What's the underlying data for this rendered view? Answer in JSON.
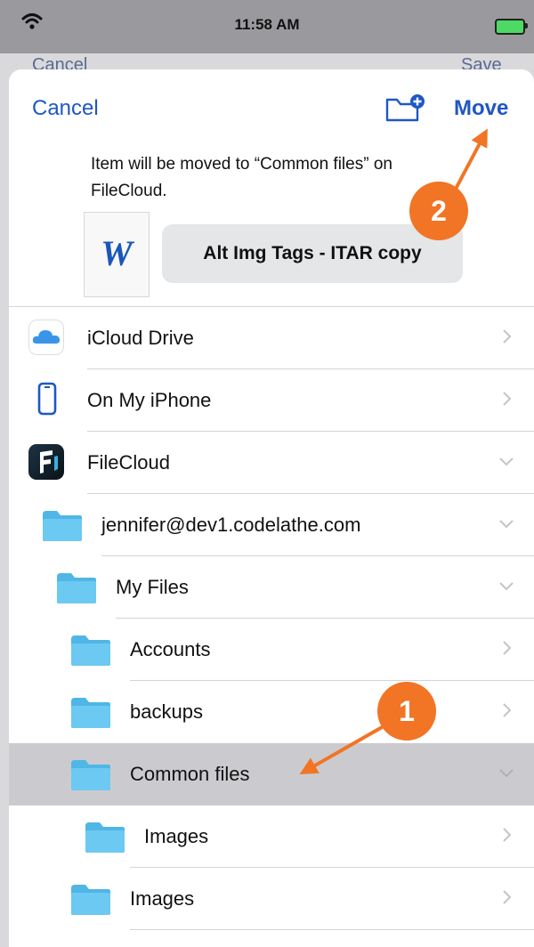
{
  "status_bar": {
    "time": "11:58 AM"
  },
  "behind_sheet": {
    "cancel": "Cancel",
    "save": "Save"
  },
  "header": {
    "cancel": "Cancel",
    "new_folder_icon": "folder-plus-icon",
    "move": "Move"
  },
  "message": "Item will be moved to “Common files” on FileCloud.",
  "document": {
    "icon_letter": "W",
    "name": "Alt Img Tags - ITAR copy"
  },
  "tree": [
    {
      "label": "iCloud Drive",
      "icon": "icloud-icon",
      "chevron": "right"
    },
    {
      "label": "On My iPhone",
      "icon": "iphone-icon",
      "chevron": "right"
    },
    {
      "label": "FileCloud",
      "icon": "filecloud-app-icon",
      "chevron": "down"
    },
    {
      "label": "jennifer@dev1.codelathe.com",
      "icon": "folder-icon",
      "chevron": "down"
    },
    {
      "label": "My Files",
      "icon": "folder-icon",
      "chevron": "down"
    },
    {
      "label": "Accounts",
      "icon": "folder-icon",
      "chevron": "right"
    },
    {
      "label": "backups",
      "icon": "folder-icon",
      "chevron": "right"
    },
    {
      "label": "Common files",
      "icon": "folder-icon",
      "chevron": "down",
      "selected": true
    },
    {
      "label": "Images",
      "icon": "folder-icon",
      "chevron": "right"
    },
    {
      "label": "Images",
      "icon": "folder-icon",
      "chevron": "right"
    }
  ],
  "annotations": {
    "badge_1": "1",
    "badge_2": "2"
  },
  "colors": {
    "accent": "#1f57c4",
    "annotation": "#f27425",
    "folder": "#5bc3f0",
    "selected_row": "#cbcbcf"
  }
}
